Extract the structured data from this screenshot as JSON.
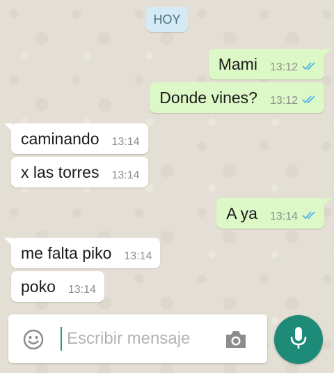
{
  "chat": {
    "date_label": "HOY",
    "messages": [
      {
        "text": "Mami",
        "time": "13:12",
        "direction": "outgoing",
        "status": "read"
      },
      {
        "text": "Donde vines?",
        "time": "13:12",
        "direction": "outgoing",
        "status": "read"
      },
      {
        "text": "caminando",
        "time": "13:14",
        "direction": "incoming"
      },
      {
        "text": "x las torres",
        "time": "13:14",
        "direction": "incoming"
      },
      {
        "text": "A ya",
        "time": "13:14",
        "direction": "outgoing",
        "status": "read"
      },
      {
        "text": "me falta piko",
        "time": "13:14",
        "direction": "incoming"
      },
      {
        "text": "poko",
        "time": "13:14",
        "direction": "incoming"
      }
    ]
  },
  "composer": {
    "placeholder": "Escribir mensaje",
    "emoji_icon": "smiley-icon",
    "camera_icon": "camera-icon",
    "mic_icon": "microphone-icon"
  },
  "colors": {
    "outgoing_bubble": "#dcf8c6",
    "incoming_bubble": "#ffffff",
    "read_ticks": "#4fb3e8",
    "accent": "#1e8a78"
  }
}
